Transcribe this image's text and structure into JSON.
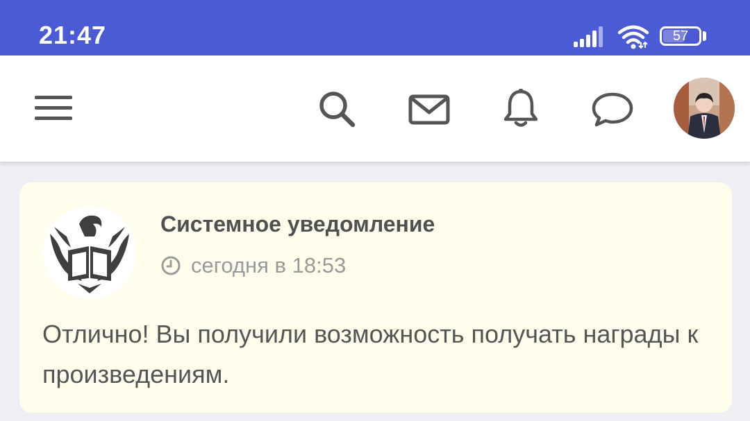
{
  "status_bar": {
    "time": "21:47",
    "battery_level": "57",
    "icons": [
      "signal-icon",
      "wifi-icon",
      "battery-icon"
    ]
  },
  "app_bar": {
    "icons": [
      "menu-icon",
      "search-icon",
      "mail-icon",
      "bell-icon",
      "chat-icon",
      "user-avatar"
    ]
  },
  "notification": {
    "sender": "Системное уведомление",
    "time": "сегодня в 18:53",
    "message": "Отлично! Вы получили возможность получать награды к произведениям."
  },
  "colors": {
    "status_bar": "#4b5bd5",
    "card_background": "#fffdeb",
    "page_background": "#eeeef3"
  }
}
